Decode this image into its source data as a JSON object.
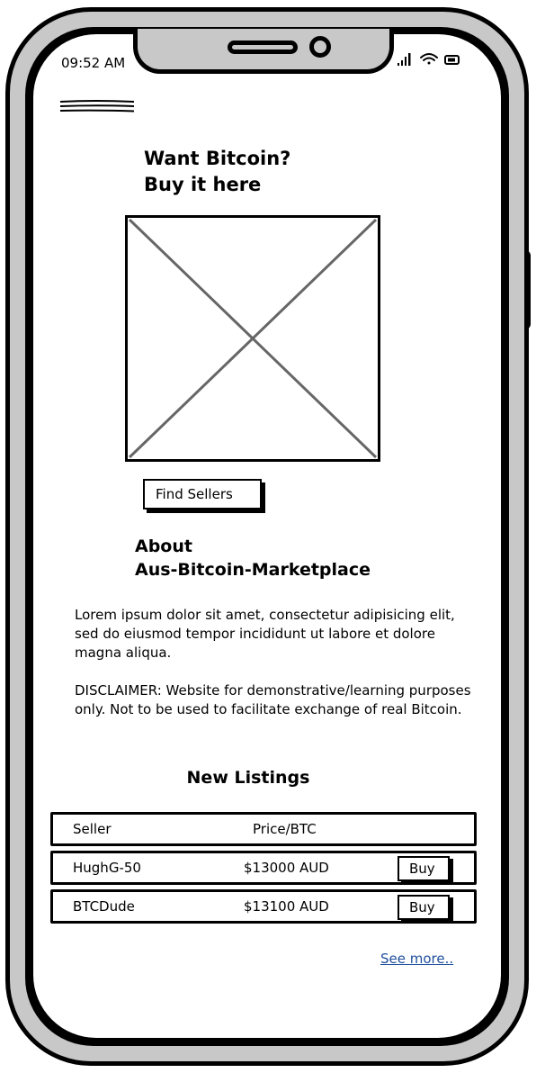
{
  "status_bar": {
    "time": "09:52 AM"
  },
  "hero": {
    "title_line1": "Want Bitcoin?",
    "title_line2": "Buy it here",
    "find_sellers_label": "Find Sellers"
  },
  "about": {
    "title_line1": "About",
    "title_line2": "Aus-Bitcoin-Marketplace",
    "paragraph": "Lorem ipsum dolor sit amet, consectetur adipisicing elit, sed do eiusmod tempor incididunt ut labore et dolore magna aliqua.",
    "disclaimer": "DISCLAIMER: Website for demonstrative/learning purposes only. Not to be used to facilitate exchange of real Bitcoin."
  },
  "listings": {
    "title": "New Listings",
    "columns": {
      "seller": "Seller",
      "price": "Price/BTC"
    },
    "rows": [
      {
        "seller": "HughG-50",
        "price": "$13000 AUD",
        "action": "Buy"
      },
      {
        "seller": "BTCDude",
        "price": "$13100 AUD",
        "action": "Buy"
      }
    ],
    "see_more_label": "See more.."
  }
}
